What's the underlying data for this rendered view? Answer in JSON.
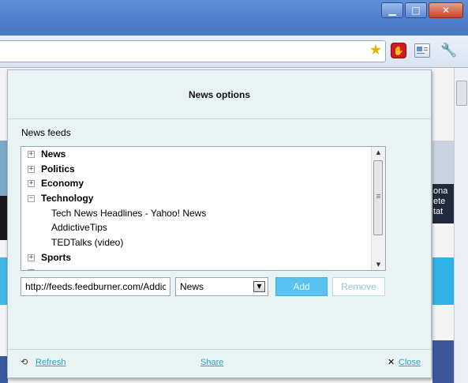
{
  "browser": {
    "window_controls": [
      "minimize",
      "maximize",
      "close"
    ],
    "toolbar_icons": [
      "star-icon",
      "adblock-icon",
      "news-extension-icon",
      "wrench-icon"
    ]
  },
  "background_page": {
    "right_column_text": [
      "ona",
      "ete",
      "tat"
    ]
  },
  "popup": {
    "title": "News options",
    "section_label": "News feeds",
    "tree": [
      {
        "label": "News",
        "expanded": false,
        "feeds": []
      },
      {
        "label": "Politics",
        "expanded": false,
        "feeds": []
      },
      {
        "label": "Economy",
        "expanded": false,
        "feeds": []
      },
      {
        "label": "Technology",
        "expanded": true,
        "feeds": [
          "Tech News Headlines - Yahoo! News",
          "AddictiveTips",
          "TEDTalks (video)"
        ]
      },
      {
        "label": "Sports",
        "expanded": false,
        "feeds": []
      }
    ],
    "url_input_value": "http://feeds.feedburner.com/Addic",
    "category_select_value": "News",
    "add_label": "Add",
    "remove_label": "Remove",
    "footer": {
      "refresh_label": "Refresh",
      "share_label": "Share",
      "close_label": "Close"
    }
  },
  "colors": {
    "popup_bg": "#eaf3f4",
    "add_button": "#56c3f0",
    "link": "#3a9fc6",
    "titlebar": "#5f8fd6"
  }
}
